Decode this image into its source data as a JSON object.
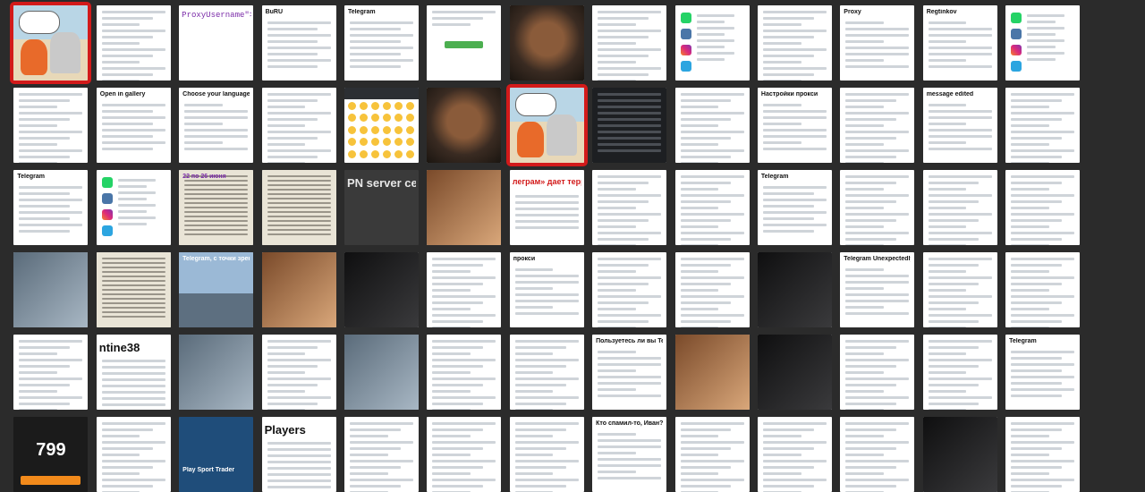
{
  "page": {
    "background": "#2b2b2b",
    "selection_color": "#d21a1a"
  },
  "grid": {
    "columns": 13,
    "rows": 6,
    "tiles": [
      {
        "kind": "cartoon",
        "selected": true
      },
      {
        "kind": "lines"
      },
      {
        "kind": "mono",
        "text": "ProxyUsername\">Лог"
      },
      {
        "kind": "chat",
        "heading": "BuRU"
      },
      {
        "kind": "chat",
        "heading": "Telegram"
      },
      {
        "kind": "greenbtn"
      },
      {
        "kind": "animal"
      },
      {
        "kind": "lines"
      },
      {
        "kind": "apps"
      },
      {
        "kind": "lines"
      },
      {
        "kind": "heading",
        "heading": "Proxy"
      },
      {
        "kind": "heading",
        "heading": "Regtinkov"
      },
      {
        "kind": "apps"
      },
      {
        "kind": "lines"
      },
      {
        "kind": "chat",
        "heading": "Open in gallery"
      },
      {
        "kind": "heading",
        "heading": "Choose your language"
      },
      {
        "kind": "lines"
      },
      {
        "kind": "emoji"
      },
      {
        "kind": "animal"
      },
      {
        "kind": "cartoon",
        "selected": true
      },
      {
        "kind": "dark"
      },
      {
        "kind": "lines"
      },
      {
        "kind": "heading",
        "heading": "Настройки прокси"
      },
      {
        "kind": "lines"
      },
      {
        "kind": "heading",
        "heading": "message edited"
      },
      {
        "kind": "lines"
      },
      {
        "kind": "chat",
        "heading": "Telegram"
      },
      {
        "kind": "apps"
      },
      {
        "kind": "paper",
        "heading": "22 по 26 июня"
      },
      {
        "kind": "paper"
      },
      {
        "kind": "bigdark",
        "text": "PN server certif"
      },
      {
        "kind": "photo",
        "style": "warm"
      },
      {
        "kind": "redhead",
        "text": "леграм» дает террорис"
      },
      {
        "kind": "lines"
      },
      {
        "kind": "lines"
      },
      {
        "kind": "chat",
        "heading": "Telegram"
      },
      {
        "kind": "lines"
      },
      {
        "kind": "lines"
      },
      {
        "kind": "lines"
      },
      {
        "kind": "photo",
        "style": "plain"
      },
      {
        "kind": "paper"
      },
      {
        "kind": "photo",
        "style": "city",
        "heading": "Telegram, с точки зрения СМИ"
      },
      {
        "kind": "photo",
        "style": "warm"
      },
      {
        "kind": "photo",
        "style": "black"
      },
      {
        "kind": "lines"
      },
      {
        "kind": "heading",
        "heading": "прокси"
      },
      {
        "kind": "lines"
      },
      {
        "kind": "lines"
      },
      {
        "kind": "photo",
        "style": "black"
      },
      {
        "kind": "heading",
        "heading": "Telegram Unexpectedly Quit"
      },
      {
        "kind": "lines"
      },
      {
        "kind": "lines"
      },
      {
        "kind": "lines"
      },
      {
        "kind": "bigwhite",
        "text": "ntine38"
      },
      {
        "kind": "photo",
        "style": "plain"
      },
      {
        "kind": "lines"
      },
      {
        "kind": "photo",
        "style": "plain"
      },
      {
        "kind": "lines"
      },
      {
        "kind": "lines"
      },
      {
        "kind": "heading",
        "heading": "Пользуетесь ли вы Telegram?"
      },
      {
        "kind": "photo",
        "style": "warm"
      },
      {
        "kind": "photo",
        "style": "black"
      },
      {
        "kind": "lines"
      },
      {
        "kind": "lines"
      },
      {
        "kind": "chat",
        "heading": "Telegram"
      },
      {
        "kind": "spin",
        "text": "799"
      },
      {
        "kind": "lines"
      },
      {
        "kind": "blue",
        "heading": "Play Sport Trader"
      },
      {
        "kind": "bigwhite",
        "text": "Players"
      },
      {
        "kind": "lines"
      },
      {
        "kind": "lines"
      },
      {
        "kind": "lines"
      },
      {
        "kind": "heading",
        "heading": "Кто спамил-то, Иван?"
      },
      {
        "kind": "lines"
      },
      {
        "kind": "lines"
      },
      {
        "kind": "lines"
      },
      {
        "kind": "photo",
        "style": "black"
      },
      {
        "kind": "lines"
      }
    ]
  }
}
